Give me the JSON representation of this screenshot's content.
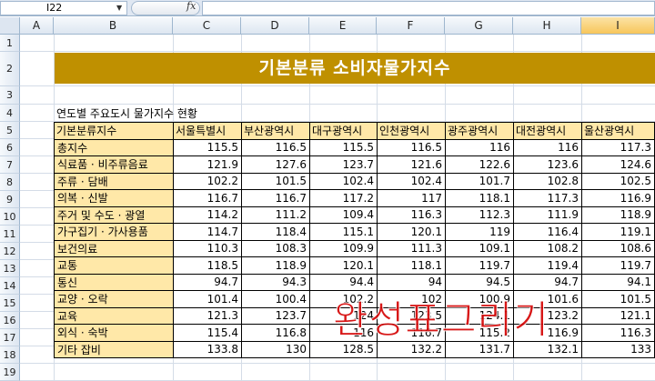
{
  "formula_bar": {
    "cell_ref": "I22",
    "fx": "fx"
  },
  "columns": [
    "A",
    "B",
    "C",
    "D",
    "E",
    "F",
    "G",
    "H",
    "I"
  ],
  "rows": [
    "1",
    "2",
    "3",
    "4",
    "5",
    "6",
    "7",
    "8",
    "9",
    "10",
    "11",
    "12",
    "13",
    "14",
    "15",
    "16",
    "17",
    "18",
    "19"
  ],
  "title": "기본분류 소비자물가지수",
  "caption": "연도별 주요도시 물가지수 현황",
  "table": {
    "headers": [
      "기본분류지수",
      "서울특별시",
      "부산광역시",
      "대구광역시",
      "인천광역시",
      "광주광역시",
      "대전광역시",
      "울산광역시"
    ],
    "rows": [
      {
        "label": "총지수",
        "values": [
          "115.5",
          "116.5",
          "115.5",
          "116.5",
          "116",
          "116",
          "117.3"
        ]
      },
      {
        "label": "식료품 · 비주류음료",
        "values": [
          "121.9",
          "127.6",
          "123.7",
          "121.6",
          "122.6",
          "123.6",
          "124.6"
        ]
      },
      {
        "label": "주류 · 담배",
        "values": [
          "102.2",
          "101.5",
          "102.4",
          "102.4",
          "101.7",
          "102.8",
          "102.5"
        ]
      },
      {
        "label": "의복 · 신발",
        "values": [
          "116.7",
          "116.7",
          "117.2",
          "117",
          "118.1",
          "117.3",
          "116.9"
        ]
      },
      {
        "label": "주거 및 수도 · 광열",
        "values": [
          "114.2",
          "111.2",
          "109.4",
          "116.3",
          "112.3",
          "111.9",
          "118.9"
        ]
      },
      {
        "label": "가구집기 · 가사용품",
        "values": [
          "114.7",
          "118.4",
          "115.1",
          "120.1",
          "119",
          "116.4",
          "119.1"
        ]
      },
      {
        "label": "보건의료",
        "values": [
          "110.3",
          "108.3",
          "109.9",
          "111.3",
          "109.1",
          "108.2",
          "108.6"
        ]
      },
      {
        "label": "교통",
        "values": [
          "118.5",
          "118.9",
          "120.1",
          "118.1",
          "119.7",
          "119.4",
          "119.7"
        ]
      },
      {
        "label": "통신",
        "values": [
          "94.7",
          "94.3",
          "94.4",
          "94",
          "94.5",
          "94.7",
          "94.1"
        ]
      },
      {
        "label": "교양 · 오락",
        "values": [
          "101.4",
          "100.4",
          "102.2",
          "102",
          "100.9",
          "101.6",
          "101.5"
        ]
      },
      {
        "label": "교육",
        "values": [
          "121.3",
          "123.7",
          "124",
          "123.5",
          "124.1",
          "123.2",
          "121.1"
        ]
      },
      {
        "label": "외식 · 숙박",
        "values": [
          "115.4",
          "116.8",
          "116",
          "116.7",
          "115.2",
          "116.9",
          "116.3"
        ]
      },
      {
        "label": "기타 잡비",
        "values": [
          "133.8",
          "130",
          "128.5",
          "132.2",
          "131.7",
          "132.1",
          "133"
        ]
      }
    ]
  },
  "overlay_text": "완성표그리기",
  "colors": {
    "banner": "#bf9000",
    "header_fill": "#ffe8a8",
    "overlay": "#d40000",
    "selected_column": "#f7c65b"
  }
}
